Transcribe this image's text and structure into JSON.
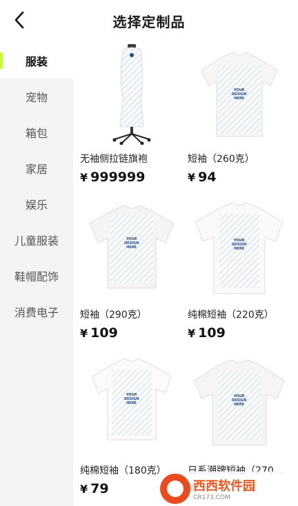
{
  "header": {
    "title": "选择定制品"
  },
  "sidebar": {
    "items": [
      {
        "label": "服装",
        "active": true
      },
      {
        "label": "宠物",
        "active": false
      },
      {
        "label": "箱包",
        "active": false
      },
      {
        "label": "家居",
        "active": false
      },
      {
        "label": "娱乐",
        "active": false
      },
      {
        "label": "儿童服装",
        "active": false
      },
      {
        "label": "鞋帽配饰",
        "active": false
      },
      {
        "label": "消费电子",
        "active": false
      }
    ],
    "accent_color": "#c6ff2a"
  },
  "products": [
    {
      "name": "无袖侧拉链旗袍",
      "currency": "¥",
      "price": "999999",
      "icon": "dress-mannequin"
    },
    {
      "name": "短袖（260克）",
      "currency": "¥",
      "price": "94",
      "icon": "tshirt"
    },
    {
      "name": "短袖（290克）",
      "currency": "¥",
      "price": "109",
      "icon": "tshirt"
    },
    {
      "name": "纯棉短袖（220克）",
      "currency": "¥",
      "price": "109",
      "icon": "tshirt"
    },
    {
      "name": "纯棉短袖（180克）",
      "currency": "¥",
      "price": "79",
      "icon": "tshirt"
    },
    {
      "name": "日系潮牌短袖（270...",
      "currency": "¥",
      "price": "",
      "icon": "tshirt"
    }
  ],
  "design_placeholder": {
    "line1": "YOUR",
    "line2": "DESIGN",
    "line3": "HERE"
  },
  "watermark": {
    "title": "西西软件园",
    "subtitle": "CR173.COM"
  }
}
